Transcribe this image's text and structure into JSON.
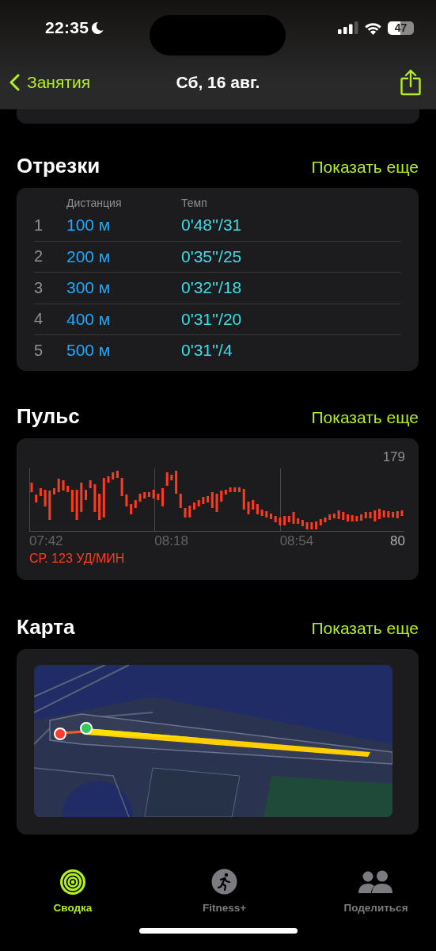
{
  "status_bar": {
    "time": "22:35",
    "battery": "47"
  },
  "nav": {
    "back": "Занятия",
    "title": "Сб, 16 авг."
  },
  "splits": {
    "title": "Отрезки",
    "more": "Показать еще",
    "columns": [
      "Дистанция",
      "Темп"
    ],
    "rows": [
      {
        "index": "1",
        "distance": "100 м",
        "pace": "0'48''/31"
      },
      {
        "index": "2",
        "distance": "200 м",
        "pace": "0'35''/25"
      },
      {
        "index": "3",
        "distance": "300 м",
        "pace": "0'32''/18"
      },
      {
        "index": "4",
        "distance": "400 м",
        "pace": "0'31''/20"
      },
      {
        "index": "5",
        "distance": "500 м",
        "pace": "0'31''/4"
      }
    ]
  },
  "heart_rate": {
    "title": "Пульс",
    "more": "Показать еще",
    "max": "179",
    "min": "80",
    "times": [
      "07:42",
      "08:18",
      "08:54"
    ],
    "average": "СР. 123 УД/МИН"
  },
  "map": {
    "title": "Карта",
    "more": "Показать еще",
    "kind": "picture"
  },
  "tabs": [
    {
      "label": "Сводка",
      "kind": "rings",
      "selected": true
    },
    {
      "label": "Fitness+",
      "kind": "runner",
      "selected": false
    },
    {
      "label": "Поделиться",
      "kind": "people",
      "selected": false
    }
  ]
}
